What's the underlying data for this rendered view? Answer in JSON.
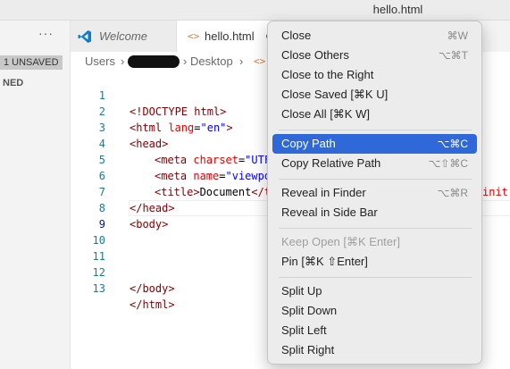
{
  "window": {
    "title": "hello.html"
  },
  "sidebar": {
    "more": "···",
    "unsaved_badge": "1 UNSAVED",
    "section": "NED"
  },
  "tabs": [
    {
      "label": "Welcome"
    },
    {
      "label": "hello.html"
    }
  ],
  "breadcrumb": {
    "users": "Users",
    "sep": "›",
    "desktop": "Desktop",
    "file_icon": "<>"
  },
  "editor": {
    "lines": [
      {
        "n": "1"
      },
      {
        "n": "2"
      },
      {
        "n": "3"
      },
      {
        "n": "4"
      },
      {
        "n": "5"
      },
      {
        "n": "6"
      },
      {
        "n": "7"
      },
      {
        "n": "8"
      },
      {
        "n": "9"
      },
      {
        "n": "10"
      },
      {
        "n": "11"
      },
      {
        "n": "12"
      },
      {
        "n": "13"
      }
    ],
    "tokens": {
      "l1": "<!DOCTYPE html>",
      "l2a": "<html ",
      "l2b": "lang",
      "l2c": "=",
      "l2d": "\"en\"",
      "l2e": ">",
      "l3": "<head>",
      "l4a": "<meta ",
      "l4b": "charset",
      "l4c": "=",
      "l4d": "\"UTF",
      "l5a": "<meta ",
      "l5b": "name",
      "l5c": "=",
      "l5d": "\"viewpo",
      "l5e": "init",
      "l6a": "<title>",
      "l6b": "Document",
      "l6c": "</t",
      "l7": "</head>",
      "l8": "<body>",
      "l12": "</body>",
      "l13": "</html>"
    }
  },
  "menu": {
    "items": [
      {
        "label": "Close",
        "shortcut": "⌘W"
      },
      {
        "label": "Close Others",
        "shortcut": "⌥⌘T"
      },
      {
        "label": "Close to the Right",
        "shortcut": ""
      },
      {
        "label": "Close Saved [⌘K U]",
        "shortcut": ""
      },
      {
        "label": "Close All [⌘K W]",
        "shortcut": ""
      },
      {
        "label": "Copy Path",
        "shortcut": "⌥⌘C"
      },
      {
        "label": "Copy Relative Path",
        "shortcut": "⌥⇧⌘C"
      },
      {
        "label": "Reveal in Finder",
        "shortcut": "⌥⌘R"
      },
      {
        "label": "Reveal in Side Bar",
        "shortcut": ""
      },
      {
        "label": "Keep Open [⌘K Enter]",
        "shortcut": ""
      },
      {
        "label": "Pin [⌘K ⇧Enter]",
        "shortcut": ""
      },
      {
        "label": "Split Up",
        "shortcut": ""
      },
      {
        "label": "Split Down",
        "shortcut": ""
      },
      {
        "label": "Split Left",
        "shortcut": ""
      },
      {
        "label": "Split Right",
        "shortcut": ""
      }
    ]
  },
  "colors": {
    "accent": "#2f68d9",
    "line_number": "#237893",
    "tag": "#800000",
    "attribute": "#e50000",
    "value": "#0000ff"
  }
}
